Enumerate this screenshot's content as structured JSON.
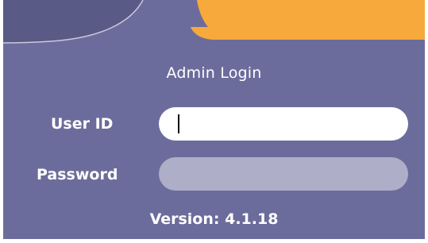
{
  "login": {
    "title": "Admin Login",
    "user_label": "User ID",
    "user_value": "",
    "user_placeholder": "",
    "password_label": "Password",
    "password_value": "",
    "password_placeholder": "",
    "version": "Version: 4.1.18"
  },
  "colors": {
    "background": "#6c6c9c",
    "accent_orange": "#f7a93b",
    "password_field": "#aeaec8",
    "text": "#ffffff"
  }
}
